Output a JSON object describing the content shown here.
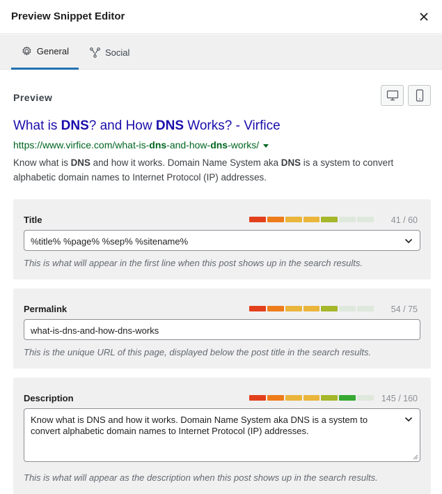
{
  "header": {
    "title": "Preview Snippet Editor",
    "close_icon": "close-icon"
  },
  "tabs": [
    {
      "label": "General",
      "icon": "gear-icon",
      "active": true
    },
    {
      "label": "Social",
      "icon": "share-nodes-icon",
      "active": false
    }
  ],
  "preview": {
    "label": "Preview",
    "devices": [
      "desktop-icon",
      "mobile-icon"
    ],
    "serp": {
      "title_parts": [
        "What is ",
        "DNS",
        "? and How ",
        "DNS",
        " Works? - Virfice"
      ],
      "url_parts": [
        "https://www.virfice.com/what-is-",
        "dns",
        "-and-how-",
        "dns",
        "-works/"
      ],
      "desc_parts": [
        "Know what is ",
        "DNS",
        " and how it works. Domain Name System aka ",
        "DNS",
        " is a system to convert alphabetic domain names to Internet Protocol (IP) addresses."
      ]
    }
  },
  "fields": {
    "title": {
      "label": "Title",
      "count": "41 / 60",
      "value": "%title% %page% %sep% %sitename%",
      "help": "This is what will appear in the first line when this post shows up in the search results."
    },
    "permalink": {
      "label": "Permalink",
      "count": "54 / 75",
      "value": "what-is-dns-and-how-dns-works",
      "help": "This is the unique URL of this page, displayed below the post title in the search results."
    },
    "description": {
      "label": "Description",
      "count": "145 / 160",
      "value": "Know what is DNS and how it works. Domain Name System aka DNS is a system to convert alphabetic domain names to Internet Protocol (IP) addresses.",
      "help": "This is what will appear as the description when this post shows up in the search results."
    }
  },
  "colors": {
    "accent": "#2271b1",
    "serp_title": "#1a0dab",
    "serp_url": "#006621",
    "meter_red": "#e2401c",
    "meter_orange": "#ee7c1b",
    "meter_yellow": "#e9b53b",
    "meter_lime": "#a5b72a",
    "meter_green": "#36a932",
    "meter_empty": "#dfe8dc"
  }
}
